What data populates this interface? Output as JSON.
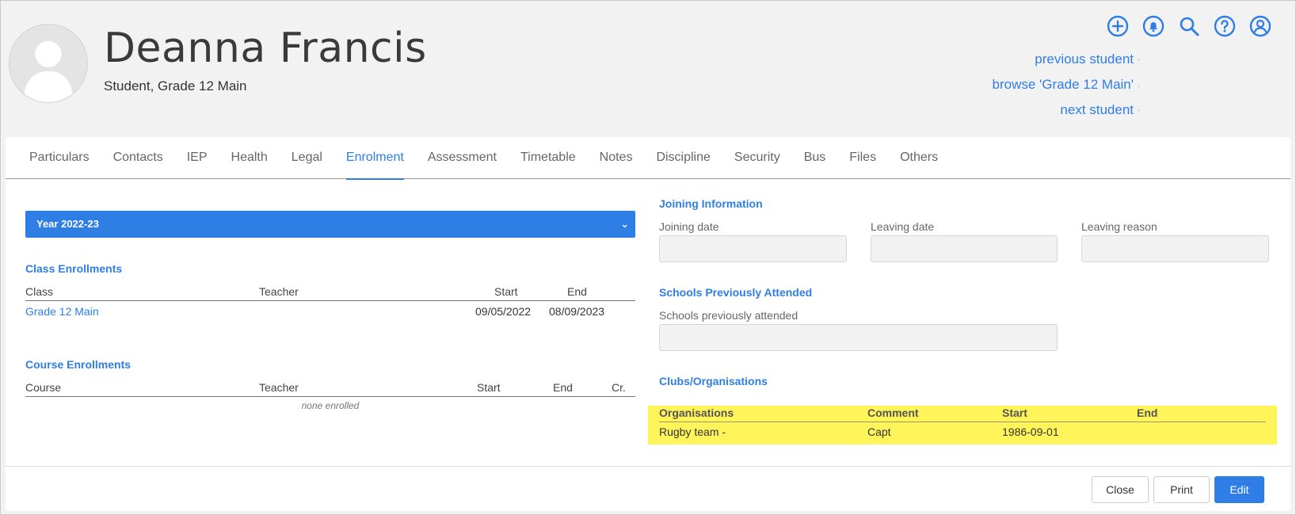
{
  "student": {
    "name": "Deanna Francis",
    "subtitle": "Student, Grade 12 Main"
  },
  "header": {
    "icons": [
      "add-icon",
      "bell-icon",
      "search-icon",
      "help-icon",
      "account-icon"
    ],
    "nav": {
      "previous": "previous student",
      "browse": "browse 'Grade 12 Main'",
      "next": "next student"
    }
  },
  "tabs": [
    {
      "label": "Particulars"
    },
    {
      "label": "Contacts"
    },
    {
      "label": "IEP"
    },
    {
      "label": "Health"
    },
    {
      "label": "Legal"
    },
    {
      "label": "Enrolment",
      "active": true
    },
    {
      "label": "Assessment"
    },
    {
      "label": "Timetable"
    },
    {
      "label": "Notes"
    },
    {
      "label": "Discipline"
    },
    {
      "label": "Security"
    },
    {
      "label": "Bus"
    },
    {
      "label": "Files"
    },
    {
      "label": "Others"
    }
  ],
  "year_select": {
    "value": "Year 2022-23"
  },
  "class_enrollments": {
    "title": "Class Enrollments",
    "columns": {
      "class": "Class",
      "teacher": "Teacher",
      "start": "Start",
      "end": "End"
    },
    "rows": [
      {
        "class": "Grade 12 Main",
        "teacher": "",
        "start": "09/05/2022",
        "end": "08/09/2023"
      }
    ]
  },
  "course_enrollments": {
    "title": "Course Enrollments",
    "columns": {
      "course": "Course",
      "teacher": "Teacher",
      "start": "Start",
      "end": "End",
      "credits": "Cr."
    },
    "empty": "none enrolled"
  },
  "joining": {
    "title": "Joining Information",
    "joining_date_label": "Joining date",
    "leaving_date_label": "Leaving date",
    "leaving_reason_label": "Leaving reason",
    "joining_date": "",
    "leaving_date": "",
    "leaving_reason": ""
  },
  "schools": {
    "title": "Schools Previously Attended",
    "label": "Schools previously attended",
    "value": ""
  },
  "clubs": {
    "title": "Clubs/Organisations",
    "columns": {
      "org": "Organisations",
      "comment": "Comment",
      "start": "Start",
      "end": "End"
    },
    "rows": [
      {
        "org": "Rugby team -",
        "comment": "Capt",
        "start": "1986-09-01",
        "end": ""
      }
    ],
    "highlight_color": "#fff45a"
  },
  "footer": {
    "close": "Close",
    "print": "Print",
    "edit": "Edit"
  },
  "colors": {
    "accent": "#2f7ee6"
  }
}
